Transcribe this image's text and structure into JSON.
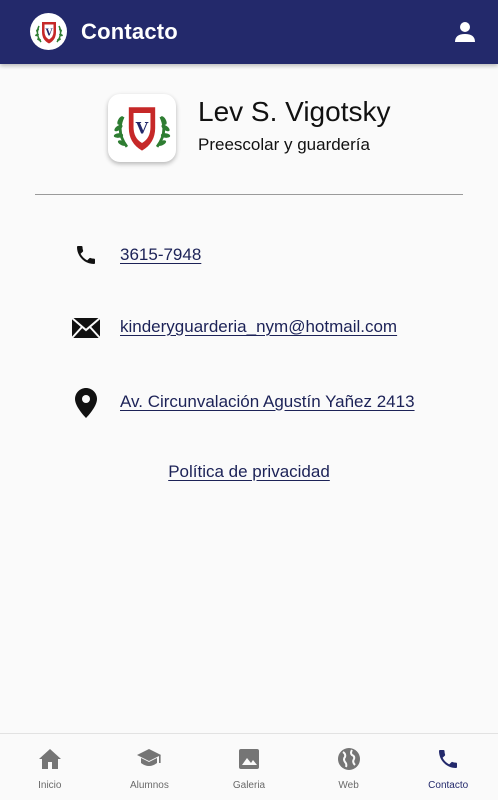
{
  "appbar": {
    "title": "Contacto",
    "logo_icon": "school-shield-icon",
    "account_icon": "account-icon",
    "background": "#23296b"
  },
  "school": {
    "name": "Lev S. Vigotsky",
    "subtitle": "Preescolar y guardería",
    "logo_letter": "V"
  },
  "contact": {
    "phone": {
      "icon": "phone-icon",
      "text": "3615-7948"
    },
    "email": {
      "icon": "mail-icon",
      "text": "kinderyguarderia_nym@hotmail.com"
    },
    "address": {
      "icon": "location-pin-icon",
      "text": "Av. Circunvalación Agustín Yañez 2413"
    }
  },
  "privacy": {
    "label": "Política de privacidad"
  },
  "bottom_nav": {
    "active": "Contacto",
    "active_color": "#23296b",
    "items": [
      {
        "label": "Inicio",
        "icon": "home-icon"
      },
      {
        "label": "Alumnos",
        "icon": "graduation-cap-icon"
      },
      {
        "label": "Galeria",
        "icon": "image-icon"
      },
      {
        "label": "Web",
        "icon": "globe-icon"
      },
      {
        "label": "Contacto",
        "icon": "phone-icon"
      }
    ]
  }
}
